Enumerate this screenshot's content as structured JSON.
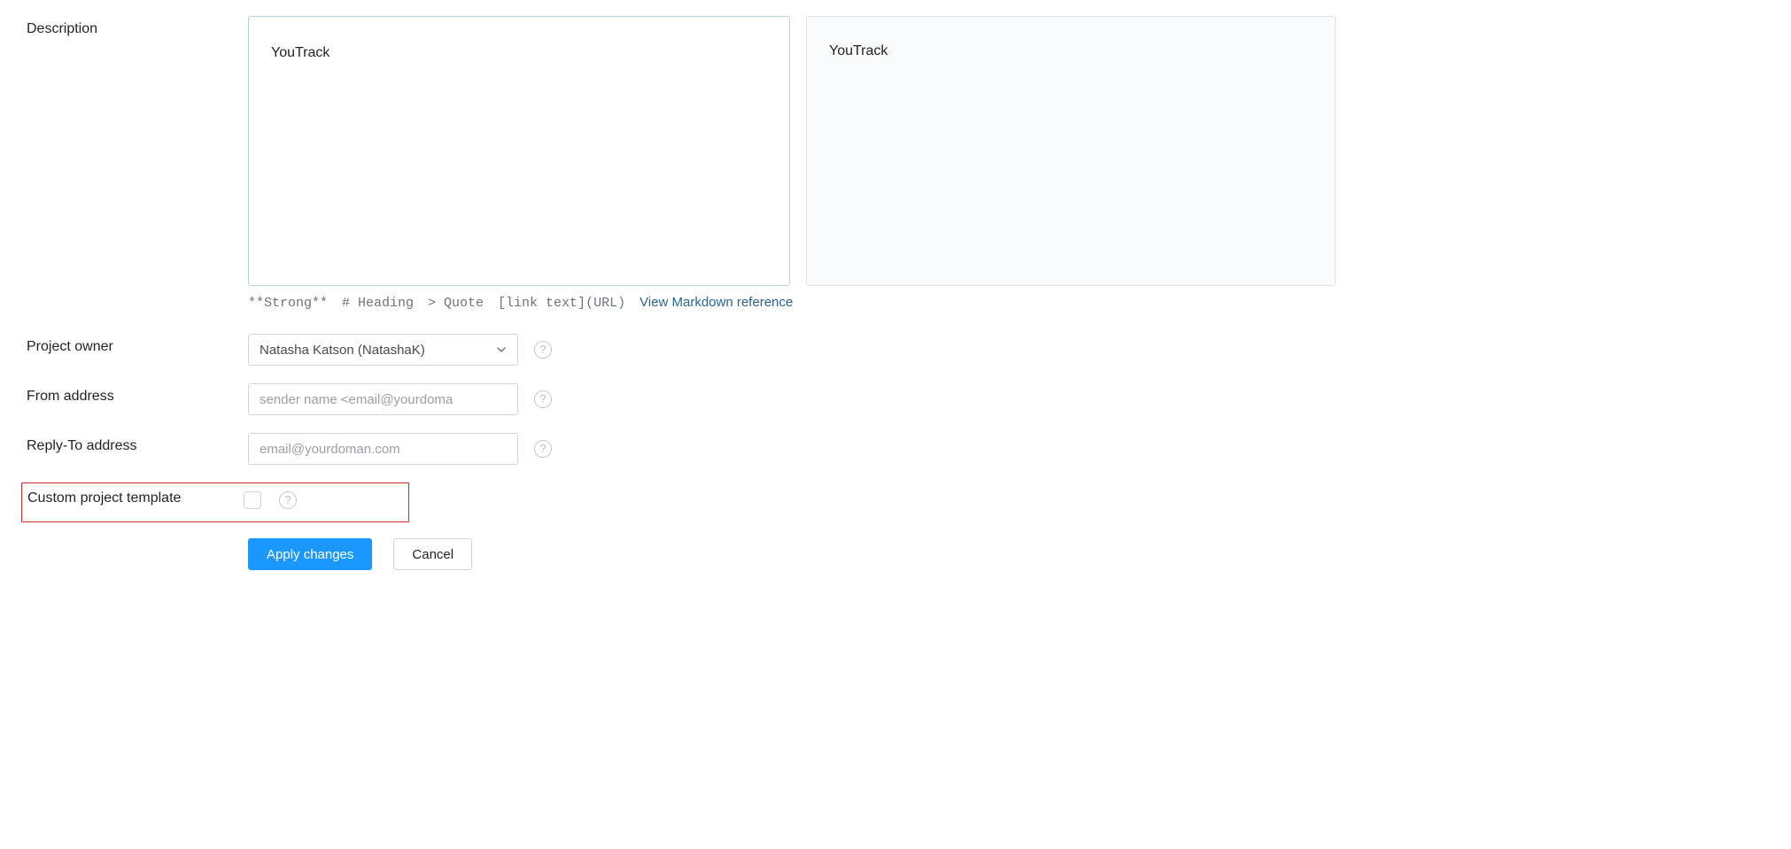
{
  "labels": {
    "description": "Description",
    "project_owner": "Project owner",
    "from_address": "From address",
    "reply_to": "Reply-To address",
    "custom_template": "Custom project template"
  },
  "description": {
    "value": "YouTrack",
    "preview": "YouTrack"
  },
  "markdown_hints": {
    "strong": "**Strong**",
    "heading": "# Heading",
    "quote": "> Quote",
    "link": "[link text](URL)",
    "ref_label": "View Markdown reference"
  },
  "project_owner": {
    "selected": "Natasha Katson (NatashaK)"
  },
  "from_address": {
    "value": "",
    "placeholder": "sender name <email@yourdoma"
  },
  "reply_to": {
    "value": "",
    "placeholder": "email@yourdoman.com"
  },
  "custom_template": {
    "checked": false
  },
  "buttons": {
    "apply": "Apply changes",
    "cancel": "Cancel"
  },
  "glyphs": {
    "help": "?"
  }
}
